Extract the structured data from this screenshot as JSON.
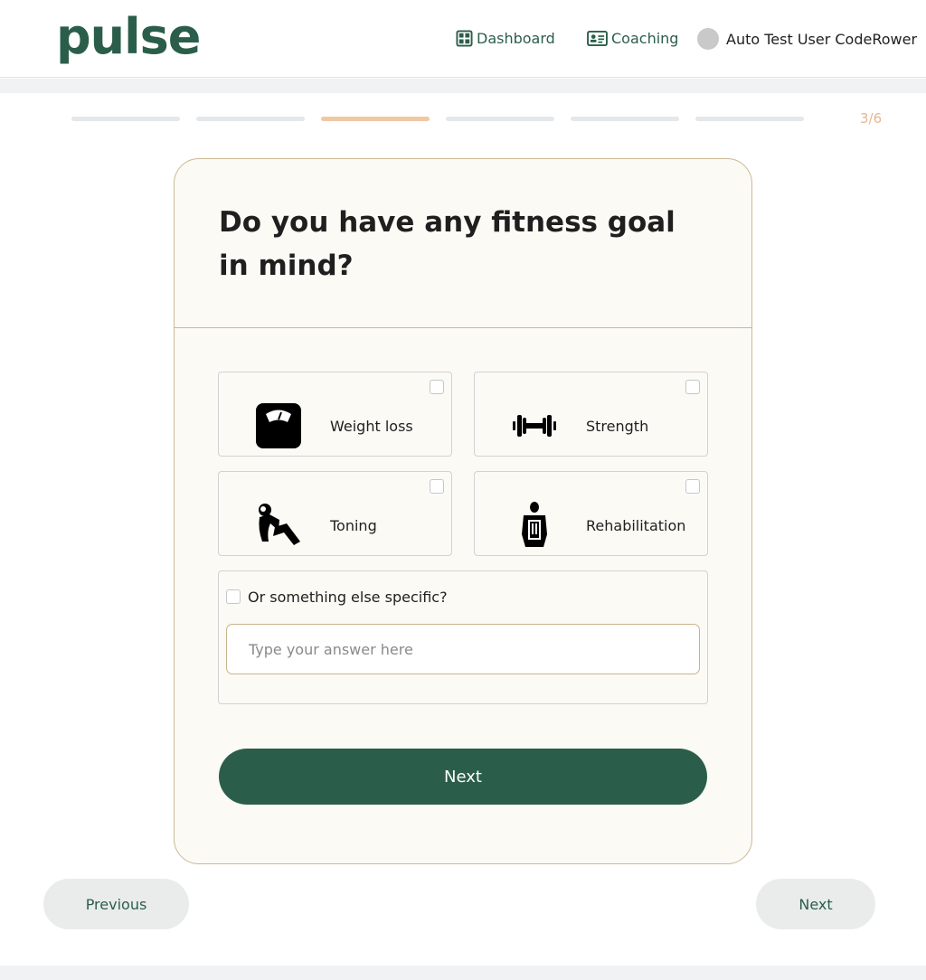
{
  "header": {
    "logo": "pulse",
    "nav": [
      {
        "label": "Dashboard",
        "icon": "dashboard-grid-icon"
      },
      {
        "label": "Coaching",
        "icon": "id-card-icon"
      }
    ],
    "user_name": "Auto Test User CodeRower"
  },
  "progress": {
    "current": 3,
    "total": 6,
    "label": "3/6"
  },
  "question": {
    "title": "Do you have any fitness goal in mind?",
    "options": [
      {
        "label": "Weight loss",
        "icon": "scale-icon",
        "checked": false
      },
      {
        "label": "Strength",
        "icon": "dumbbell-icon",
        "checked": false
      },
      {
        "label": "Toning",
        "icon": "situp-icon",
        "checked": false
      },
      {
        "label": "Rehabilitation",
        "icon": "rehab-icon",
        "checked": false
      }
    ],
    "other_label": "Or something else specific?",
    "other_placeholder": "Type your answer here",
    "submit_label": "Next"
  },
  "footer_nav": {
    "previous_label": "Previous",
    "next_label": "Next"
  },
  "colors": {
    "brand": "#2b5e4a",
    "accent": "#f0c8a4",
    "card_bg": "#fcfaf5",
    "card_border": "#cbb995"
  }
}
